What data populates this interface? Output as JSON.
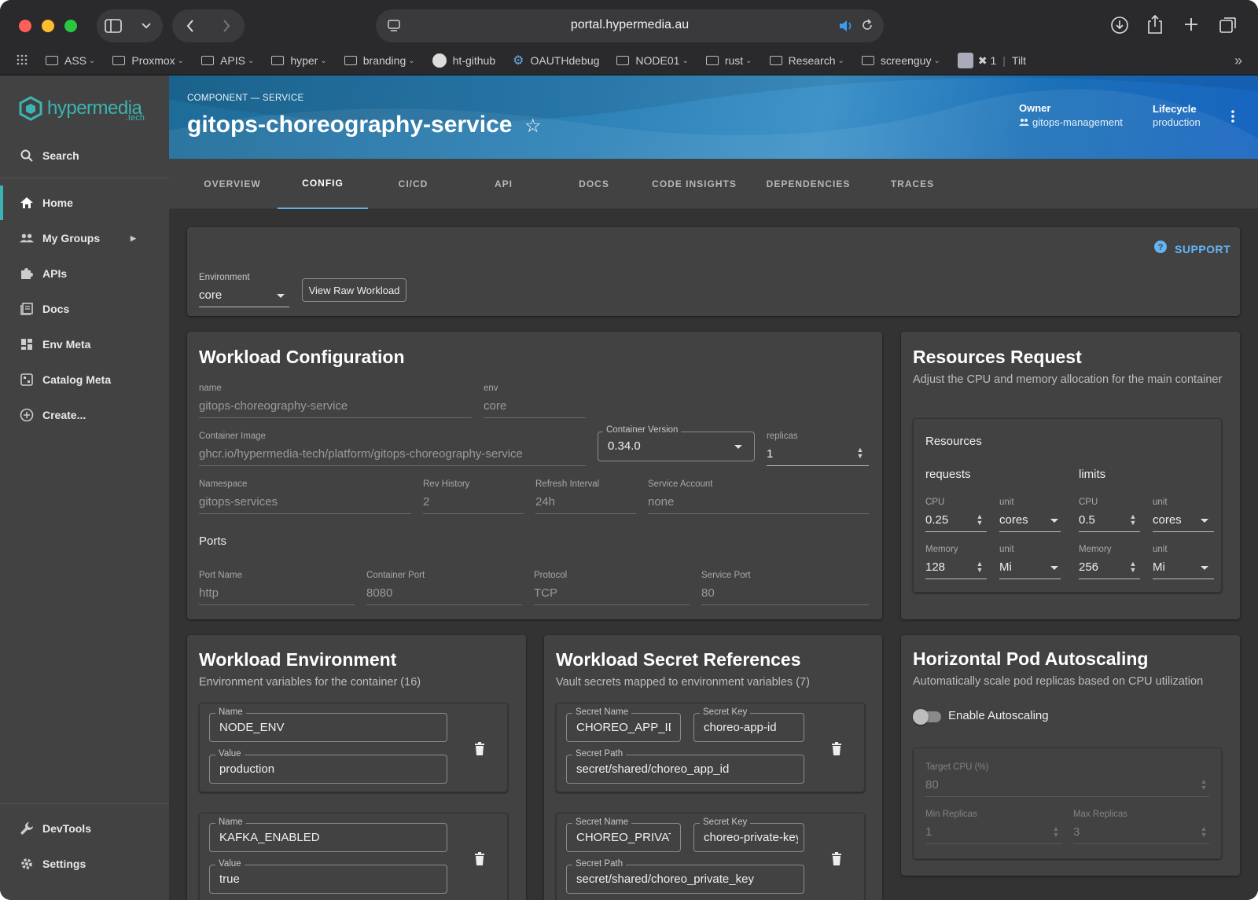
{
  "browser": {
    "url": "portal.hypermedia.au",
    "bookmarks": [
      {
        "label": "ASS",
        "type": "folder"
      },
      {
        "label": "Proxmox",
        "type": "folder"
      },
      {
        "label": "APIS",
        "type": "folder"
      },
      {
        "label": "hyper",
        "type": "folder"
      },
      {
        "label": "branding",
        "type": "folder"
      },
      {
        "label": "ht-github",
        "type": "github"
      },
      {
        "label": "OAUTHdebug",
        "type": "gear"
      },
      {
        "label": "NODE01",
        "type": "folder"
      },
      {
        "label": "rust",
        "type": "folder"
      },
      {
        "label": "Research",
        "type": "folder"
      },
      {
        "label": "screenguy",
        "type": "folder"
      }
    ],
    "extra_bookmark_count": "✖ 1",
    "extra_bookmark_label": "Tilt"
  },
  "sidebar": {
    "logo_text": "hypermedia",
    "logo_sub": ".tech",
    "search_label": "Search",
    "items": [
      {
        "label": "Home",
        "icon": "home-icon"
      },
      {
        "label": "My Groups",
        "icon": "groups-icon"
      },
      {
        "label": "APIs",
        "icon": "puzzle-icon"
      },
      {
        "label": "Docs",
        "icon": "docs-icon"
      },
      {
        "label": "Env Meta",
        "icon": "dashboard-icon"
      },
      {
        "label": "Catalog Meta",
        "icon": "catalog-icon"
      },
      {
        "label": "Create...",
        "icon": "add-circle-icon"
      }
    ],
    "bottom_items": [
      {
        "label": "DevTools",
        "icon": "wrench-icon"
      },
      {
        "label": "Settings",
        "icon": "gear-icon"
      }
    ]
  },
  "header": {
    "kicker": "COMPONENT — SERVICE",
    "title": "gitops-choreography-service",
    "owner_label": "Owner",
    "owner_value": "gitops-management",
    "lifecycle_label": "Lifecycle",
    "lifecycle_value": "production"
  },
  "tabs": [
    "OVERVIEW",
    "CONFIG",
    "CI/CD",
    "API",
    "DOCS",
    "CODE INSIGHTS",
    "DEPENDENCIES",
    "TRACES"
  ],
  "toolbar": {
    "support_label": "SUPPORT",
    "environment_label": "Environment",
    "environment_value": "core",
    "view_raw_label": "View Raw Workload"
  },
  "workload": {
    "title": "Workload Configuration",
    "name_label": "name",
    "name_value": "gitops-choreography-service",
    "env_label": "env",
    "env_value": "core",
    "image_label": "Container Image",
    "image_value": "ghcr.io/hypermedia-tech/platform/gitops-choreography-service",
    "version_label": "Container Version",
    "version_value": "0.34.0",
    "replicas_label": "replicas",
    "replicas_value": "1",
    "namespace_label": "Namespace",
    "namespace_value": "gitops-services",
    "rev_label": "Rev History",
    "rev_value": "2",
    "refresh_label": "Refresh Interval",
    "refresh_value": "24h",
    "sa_label": "Service Account",
    "sa_value": "none",
    "ports_heading": "Ports",
    "port_name_label": "Port Name",
    "port_name_value": "http",
    "container_port_label": "Container Port",
    "container_port_value": "8080",
    "protocol_label": "Protocol",
    "protocol_value": "TCP",
    "service_port_label": "Service Port",
    "service_port_value": "80"
  },
  "resources": {
    "title": "Resources Request",
    "subtitle": "Adjust the CPU and memory allocation for the main container",
    "box_title": "Resources",
    "requests_heading": "requests",
    "limits_heading": "limits",
    "cpu_label": "CPU",
    "unit_label": "unit",
    "memory_label": "Memory",
    "req_cpu": "0.25",
    "req_cpu_unit": "cores",
    "req_mem": "128",
    "req_mem_unit": "Mi",
    "lim_cpu": "0.5",
    "lim_cpu_unit": "cores",
    "lim_mem": "256",
    "lim_mem_unit": "Mi"
  },
  "env": {
    "title": "Workload Environment",
    "subtitle": "Environment variables for the container (16)",
    "name_label": "Name",
    "value_label": "Value",
    "vars": [
      {
        "name": "NODE_ENV",
        "value": "production"
      },
      {
        "name": "KAFKA_ENABLED",
        "value": "true"
      }
    ]
  },
  "secrets": {
    "title": "Workload Secret References",
    "subtitle": "Vault secrets mapped to environment variables (7)",
    "name_label": "Secret Name",
    "key_label": "Secret Key",
    "path_label": "Secret Path",
    "items": [
      {
        "name": "CHOREO_APP_ID",
        "key": "choreo-app-id",
        "path": "secret/shared/choreo_app_id"
      },
      {
        "name": "CHOREO_PRIVATE_KEY",
        "key": "choreo-private-key",
        "path": "secret/shared/choreo_private_key"
      }
    ]
  },
  "hpa": {
    "title": "Horizontal Pod Autoscaling",
    "subtitle": "Automatically scale pod replicas based on CPU utilization",
    "toggle_label": "Enable Autoscaling",
    "toggle_on": false,
    "target_cpu_label": "Target CPU (%)",
    "target_cpu_value": "80",
    "min_label": "Min Replicas",
    "min_value": "1",
    "max_label": "Max Replicas",
    "max_value": "3"
  },
  "colors": {
    "accent": "#3db3b3",
    "tab_indicator": "#5fb0e0",
    "support": "#64b5f6"
  }
}
